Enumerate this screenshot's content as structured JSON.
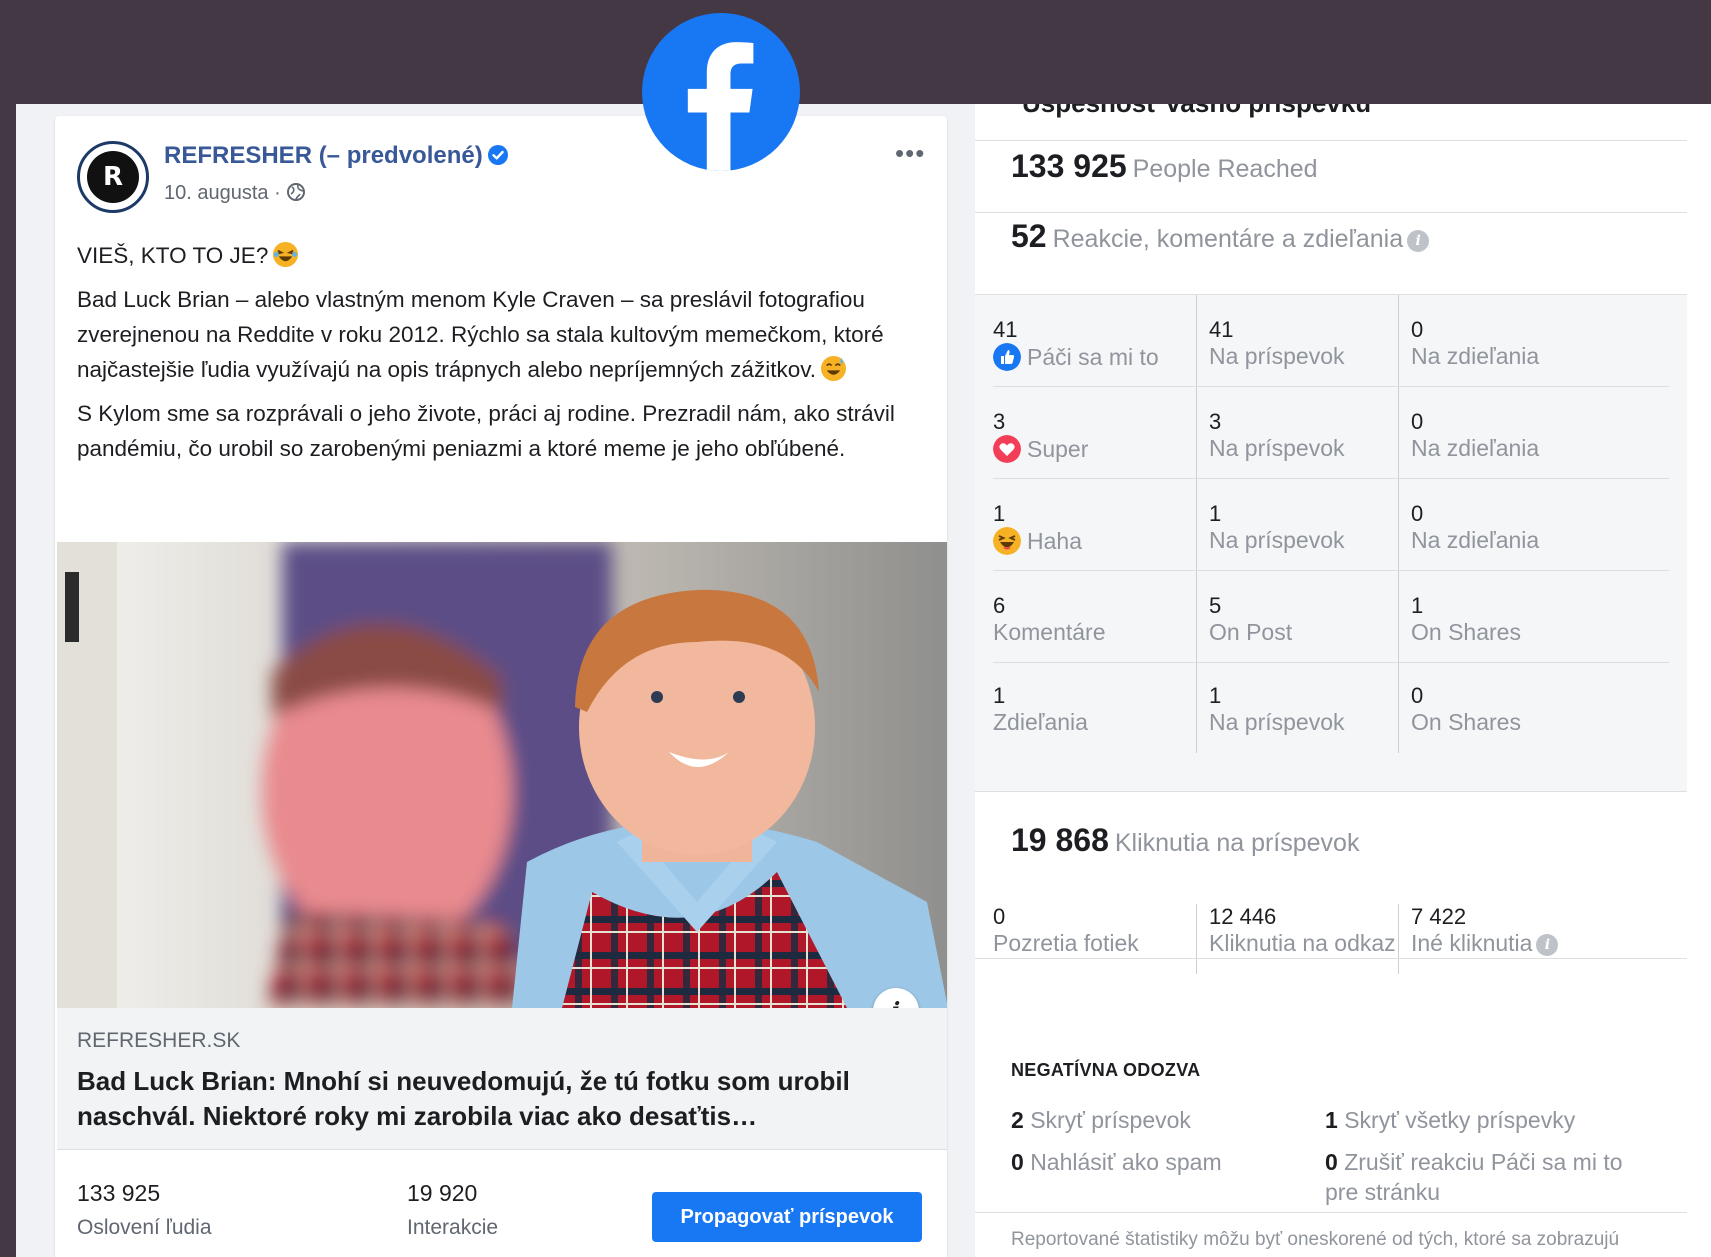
{
  "post": {
    "page_name": "REFRESHER (– predvolené)",
    "date": "10. augusta ·",
    "more": "•••",
    "line1": "VIEŠ, KTO TO JE?",
    "para1": "Bad Luck Brian – alebo vlastným menom Kyle Craven – sa preslávil fotografiou zverejnenou na Reddite v roku 2012. Rýchlo sa stala kultovým memečkom, ktoré najčastejšie ľudia využívajú na opis trápnych alebo nepríjemných zážitkov.",
    "para2": "S Kylom sme sa rozprávali o jeho živote, práci aj rodine. Prezradil nám, ako strávil pandémiu, čo urobil so zarobenými peniazmi a ktoré meme je jeho obľúbené.",
    "info_btn": "i",
    "link_domain": "REFRESHER.SK",
    "link_title": "Bad Luck Brian: Mnohí si neuvedomujú, že tú fotku som urobil naschvál. Niektoré roky mi zarobila viac ako desaťtis…",
    "stats": {
      "reached_value": "133 925",
      "reached_label": "Oslovení ľudia",
      "interactions_value": "19 920",
      "interactions_label": "Interakcie"
    },
    "promote_label": "Propagovať príspevok"
  },
  "insights": {
    "title": "Úspešnosť vášho príspevku",
    "people_reached": {
      "value": "133 925",
      "label": "People Reached"
    },
    "engagement": {
      "value": "52",
      "label": "Reakcie, komentáre a zdieľania",
      "info": "i"
    },
    "rows": [
      {
        "total": "41",
        "name": "Páči sa mi to",
        "icon": "like-icon",
        "color": "#1877f2",
        "on_post": "41",
        "on_post_label": "Na príspevok",
        "on_shares": "0",
        "on_shares_label": "Na zdieľania"
      },
      {
        "total": "3",
        "name": "Super",
        "icon": "love-icon",
        "color": "#f33e58",
        "on_post": "3",
        "on_post_label": "Na príspevok",
        "on_shares": "0",
        "on_shares_label": "Na zdieľania"
      },
      {
        "total": "1",
        "name": "Haha",
        "icon": "haha-icon",
        "color": "#f7b125",
        "on_post": "1",
        "on_post_label": "Na príspevok",
        "on_shares": "0",
        "on_shares_label": "Na zdieľania"
      },
      {
        "total": "6",
        "name": "Komentáre",
        "icon": "",
        "color": "",
        "on_post": "5",
        "on_post_label": "On Post",
        "on_shares": "1",
        "on_shares_label": "On Shares"
      },
      {
        "total": "1",
        "name": "Zdieľania",
        "icon": "",
        "color": "",
        "on_post": "1",
        "on_post_label": "Na príspevok",
        "on_shares": "0",
        "on_shares_label": "On Shares"
      }
    ],
    "post_clicks": {
      "value": "19 868",
      "label": "Kliknutia na príspevok"
    },
    "clicks": [
      {
        "value": "0",
        "label": "Pozretia fotiek"
      },
      {
        "value": "12 446",
        "label": "Kliknutia na odkaz"
      },
      {
        "value": "7 422",
        "label": "Iné kliknutia",
        "info": "i"
      }
    ],
    "negative_title": "NEGATÍVNA ODOZVA",
    "negative": [
      {
        "value": "2",
        "label": "Skryť príspevok"
      },
      {
        "value": "1",
        "label": "Skryť všetky príspevky"
      },
      {
        "value": "0",
        "label": "Nahlásiť ako spam"
      },
      {
        "value": "0",
        "label": "Zrušiť reakciu Páči sa mi to pre stránku"
      }
    ],
    "disclaimer": "Reportované štatistiky môžu byť oneskorené od tých, ktoré sa zobrazujú pri príspevkoch"
  },
  "colors": {
    "facebook_blue": "#1877f2",
    "link_blue": "#385898",
    "background": "#453845"
  }
}
